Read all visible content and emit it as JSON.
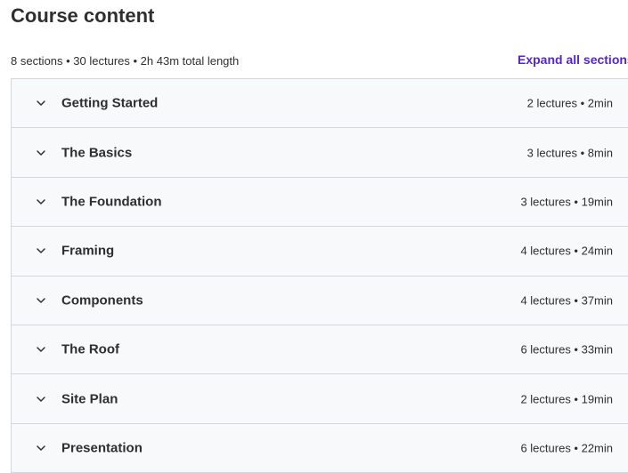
{
  "header": {
    "title": "Course content",
    "summary": "8 sections • 30 lectures • 2h 43m total length",
    "expand_all_label": "Expand all sections"
  },
  "icons": {
    "section_toggle": "chevron-down-icon"
  },
  "colors": {
    "accent": "#5624d0",
    "row_background": "#f7f9fa",
    "border": "#d1d7dc",
    "text": "#2d2f31"
  },
  "sections": [
    {
      "title": "Getting Started",
      "meta": "2 lectures • 2min"
    },
    {
      "title": "The Basics",
      "meta": "3 lectures • 8min"
    },
    {
      "title": "The Foundation",
      "meta": "3 lectures • 19min"
    },
    {
      "title": "Framing",
      "meta": "4 lectures • 24min"
    },
    {
      "title": "Components",
      "meta": "4 lectures • 37min"
    },
    {
      "title": "The Roof",
      "meta": "6 lectures • 33min"
    },
    {
      "title": "Site Plan",
      "meta": "2 lectures • 19min"
    },
    {
      "title": "Presentation",
      "meta": "6 lectures • 22min"
    }
  ]
}
